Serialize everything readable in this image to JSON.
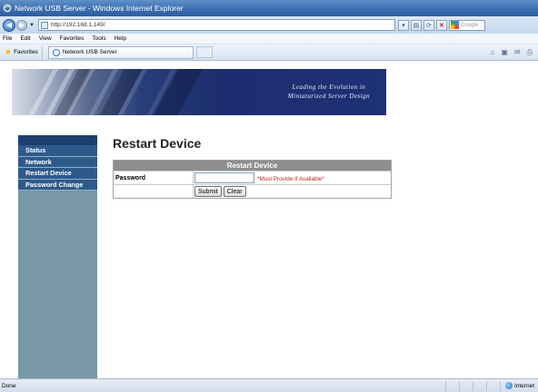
{
  "window": {
    "title": "Network USB Server - Windows Internet Explorer"
  },
  "address_bar": {
    "url": "http://192.168.1.149/",
    "search_placeholder": "Google"
  },
  "menu": [
    "File",
    "Edit",
    "View",
    "Favorites",
    "Tools",
    "Help"
  ],
  "favorites": {
    "label": "Favorites"
  },
  "tab": {
    "title": "Network USB Server"
  },
  "banner": {
    "tagline_line1": "Leading the Evolution in",
    "tagline_line2": "Miniaturized Server Design"
  },
  "sidebar": {
    "items": [
      {
        "label": "Status"
      },
      {
        "label": "Network"
      },
      {
        "label": "Restart Device"
      },
      {
        "label": "Password Change"
      }
    ]
  },
  "page": {
    "title": "Restart Device"
  },
  "form": {
    "header": "Restart Device",
    "password_label": "Password",
    "password_value": "",
    "warning": "*Must Provide If Available*",
    "submit_label": "Submit",
    "clear_label": "Clear"
  },
  "status_bar": {
    "status": "Done",
    "zone": "Internet"
  },
  "colors": {
    "sidebar_bg": "#7898a6",
    "nav_item_bg": "#2e5a8a",
    "form_header_bg": "#8e8e8e",
    "warning": "#c0251e"
  }
}
